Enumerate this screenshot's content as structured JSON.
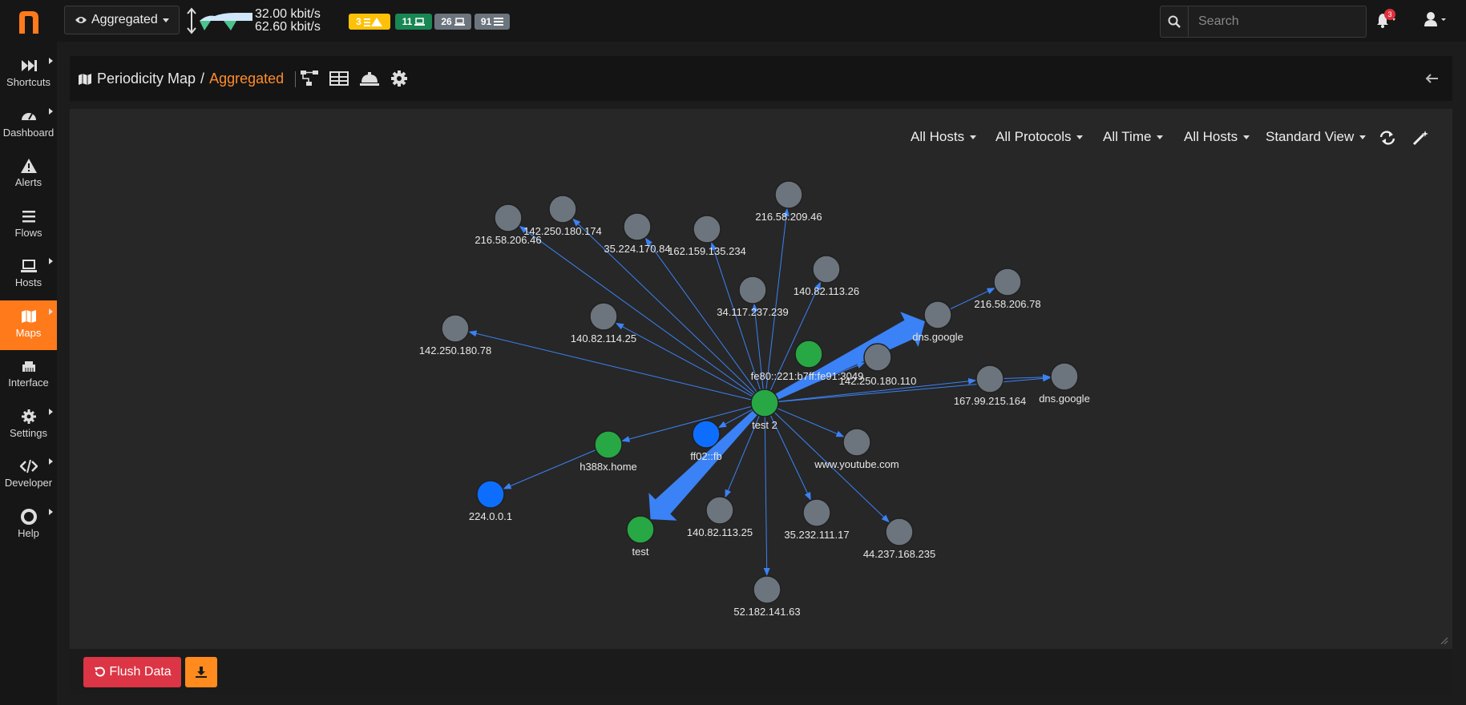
{
  "sidebar": {
    "items": [
      {
        "label": "Shortcuts",
        "icon": "fast-forward-icon"
      },
      {
        "label": "Dashboard",
        "icon": "gauge-icon"
      },
      {
        "label": "Alerts",
        "icon": "warning-icon"
      },
      {
        "label": "Flows",
        "icon": "list-icon"
      },
      {
        "label": "Hosts",
        "icon": "laptop-icon"
      },
      {
        "label": "Maps",
        "icon": "map-icon"
      },
      {
        "label": "Interface",
        "icon": "ethernet-icon"
      },
      {
        "label": "Settings",
        "icon": "gear-icon"
      },
      {
        "label": "Developer",
        "icon": "code-icon"
      },
      {
        "label": "Help",
        "icon": "lifebuoy-icon"
      }
    ],
    "active": "Maps",
    "accent": "#ff7a1a"
  },
  "topbar": {
    "view_selector": "Aggregated",
    "upload_rate": "32.00 kbit/s",
    "download_rate": "62.60 kbit/s",
    "badges": [
      {
        "value": "3",
        "icon": "list-warning-icon",
        "color": "#ffc107"
      },
      {
        "value": "11",
        "icon": "laptop-icon",
        "color": "#198754"
      },
      {
        "value": "26",
        "icon": "laptop-icon",
        "color": "#6c757d"
      },
      {
        "value": "91",
        "icon": "list-icon",
        "color": "#6c757d"
      }
    ],
    "search_placeholder": "Search",
    "notifications": "3"
  },
  "header": {
    "title": "Periodicity Map",
    "separator": "/",
    "subtitle": "Aggregated"
  },
  "filters": [
    "All Hosts",
    "All Protocols",
    "All Time",
    "All Hosts",
    "Standard View"
  ],
  "graph": {
    "nodes": [
      {
        "id": "test2",
        "label": "test 2",
        "color": "#28a745"
      },
      {
        "id": "n1",
        "label": "216.58.206.46",
        "color": "#6c757d"
      },
      {
        "id": "n2",
        "label": "142.250.180.174",
        "color": "#6c757d"
      },
      {
        "id": "n3",
        "label": "35.224.170.84",
        "color": "#6c757d"
      },
      {
        "id": "n4",
        "label": "162.159.135.234",
        "color": "#6c757d"
      },
      {
        "id": "n5",
        "label": "216.58.209.46",
        "color": "#6c757d"
      },
      {
        "id": "n6",
        "label": "140.82.113.26",
        "color": "#6c757d"
      },
      {
        "id": "n7",
        "label": "34.117.237.239",
        "color": "#6c757d"
      },
      {
        "id": "n8",
        "label": "216.58.206.78",
        "color": "#6c757d"
      },
      {
        "id": "n9",
        "label": "dns.google",
        "color": "#6c757d"
      },
      {
        "id": "n10",
        "label": "142.250.180.78",
        "color": "#6c757d"
      },
      {
        "id": "n11",
        "label": "140.82.114.25",
        "color": "#6c757d"
      },
      {
        "id": "n12",
        "label": "fe80::221:b7ff:fe91:3049",
        "color": "#28a745"
      },
      {
        "id": "n13",
        "label": "142.250.180.110",
        "color": "#6c757d"
      },
      {
        "id": "n14",
        "label": "167.99.215.164",
        "color": "#6c757d"
      },
      {
        "id": "n15",
        "label": "dns.google",
        "color": "#6c757d"
      },
      {
        "id": "n16",
        "label": "ff02::fb",
        "color": "#0d6efd"
      },
      {
        "id": "n17",
        "label": "h388x.home",
        "color": "#28a745"
      },
      {
        "id": "n18",
        "label": "224.0.0.1",
        "color": "#0d6efd"
      },
      {
        "id": "n19",
        "label": "www.youtube.com",
        "color": "#6c757d"
      },
      {
        "id": "n20",
        "label": "test",
        "color": "#28a745"
      },
      {
        "id": "n21",
        "label": "140.82.113.25",
        "color": "#6c757d"
      },
      {
        "id": "n22",
        "label": "35.232.111.17",
        "color": "#6c757d"
      },
      {
        "id": "n23",
        "label": "44.237.168.235",
        "color": "#6c757d"
      },
      {
        "id": "n24",
        "label": "52.182.141.63",
        "color": "#6c757d"
      }
    ],
    "edges": [
      {
        "from": "test2",
        "to": "n1",
        "weight": 1
      },
      {
        "from": "test2",
        "to": "n2",
        "weight": 1
      },
      {
        "from": "test2",
        "to": "n3",
        "weight": 1
      },
      {
        "from": "test2",
        "to": "n4",
        "weight": 1
      },
      {
        "from": "test2",
        "to": "n5",
        "weight": 1
      },
      {
        "from": "test2",
        "to": "n6",
        "weight": 1
      },
      {
        "from": "test2",
        "to": "n7",
        "weight": 1
      },
      {
        "from": "test2",
        "to": "n9",
        "weight": 5
      },
      {
        "from": "n9",
        "to": "n8",
        "weight": 1
      },
      {
        "from": "test2",
        "to": "n10",
        "weight": 1
      },
      {
        "from": "test2",
        "to": "n11",
        "weight": 1
      },
      {
        "from": "test2",
        "to": "n13",
        "weight": 1
      },
      {
        "from": "test2",
        "to": "n14",
        "weight": 1
      },
      {
        "from": "test2",
        "to": "n15",
        "weight": 1
      },
      {
        "from": "n14",
        "to": "n15",
        "weight": 1
      },
      {
        "from": "test2",
        "to": "n16",
        "weight": 1
      },
      {
        "from": "test2",
        "to": "n17",
        "weight": 1
      },
      {
        "from": "n17",
        "to": "n18",
        "weight": 1
      },
      {
        "from": "test2",
        "to": "n19",
        "weight": 1
      },
      {
        "from": "test2",
        "to": "n20",
        "weight": 5
      },
      {
        "from": "test2",
        "to": "n21",
        "weight": 1
      },
      {
        "from": "test2",
        "to": "n22",
        "weight": 1
      },
      {
        "from": "test2",
        "to": "n23",
        "weight": 1
      },
      {
        "from": "test2",
        "to": "n24",
        "weight": 1
      }
    ],
    "edge_color": "#3b82f6"
  },
  "footer": {
    "flush_label": "Flush Data"
  }
}
